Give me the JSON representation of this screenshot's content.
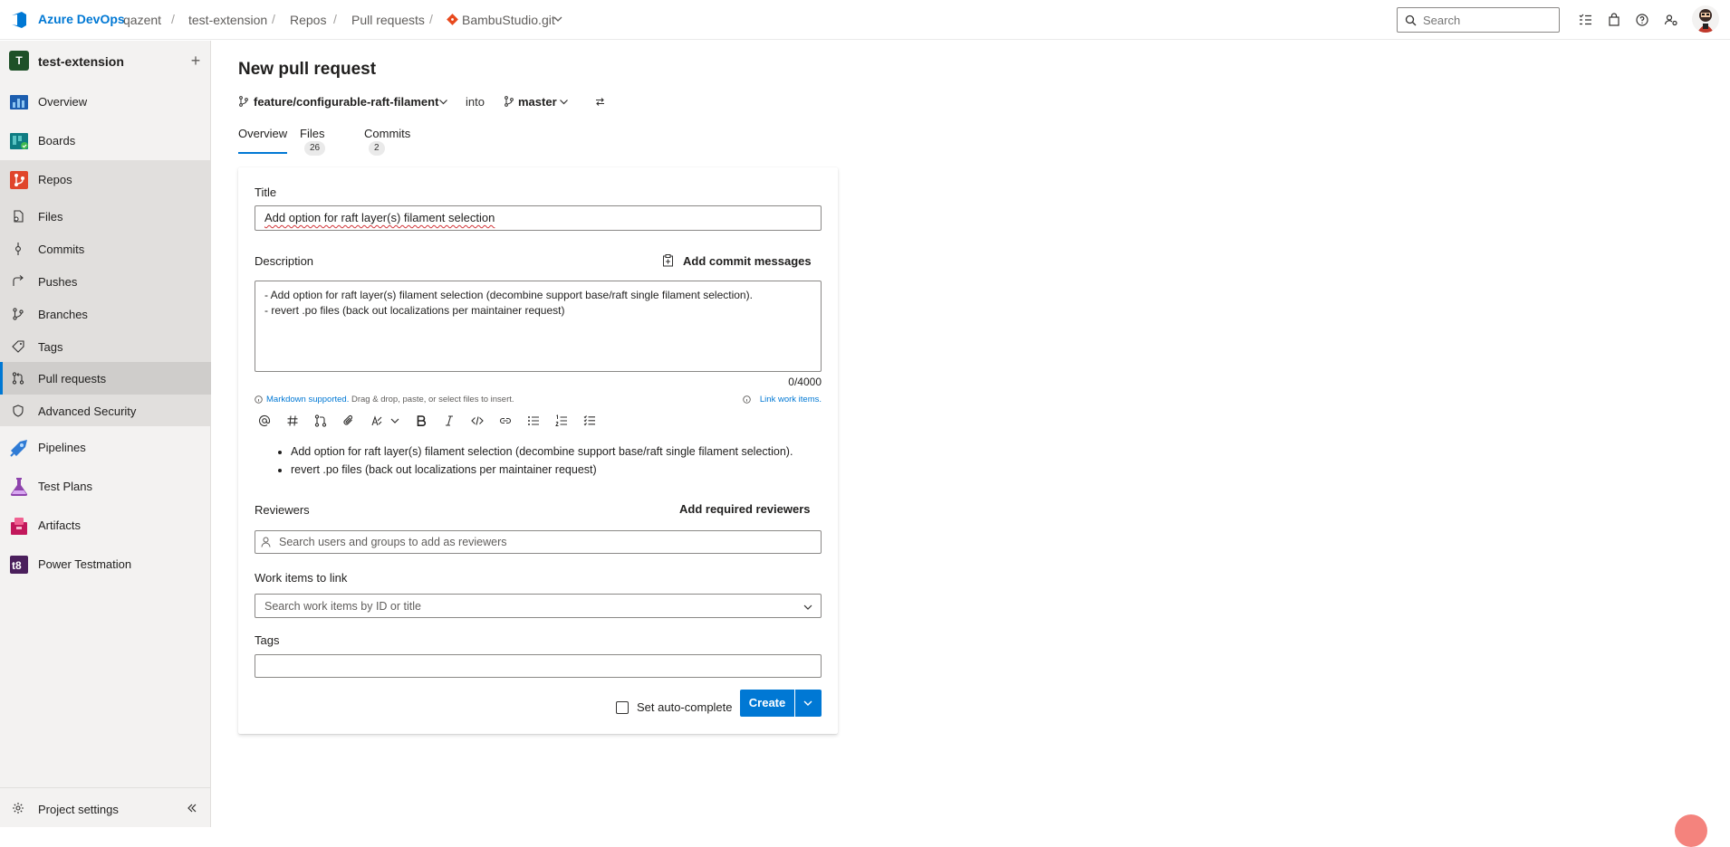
{
  "topbar": {
    "brand": "Azure DevOps",
    "breadcrumb": [
      "qazent",
      "test-extension",
      "Repos",
      "Pull requests"
    ],
    "repo": "BambuStudio.git",
    "search_placeholder": "Search"
  },
  "sidebar": {
    "project_initial": "T",
    "project_name": "test-extension",
    "items": [
      {
        "label": "Overview"
      },
      {
        "label": "Boards"
      },
      {
        "label": "Repos"
      },
      {
        "label": "Files"
      },
      {
        "label": "Commits"
      },
      {
        "label": "Pushes"
      },
      {
        "label": "Branches"
      },
      {
        "label": "Tags"
      },
      {
        "label": "Pull requests"
      },
      {
        "label": "Advanced Security"
      },
      {
        "label": "Pipelines"
      },
      {
        "label": "Test Plans"
      },
      {
        "label": "Artifacts"
      },
      {
        "label": "Power Testmation"
      }
    ],
    "settings_label": "Project settings"
  },
  "main": {
    "title": "New pull request",
    "source_branch": "feature/configurable-raft-filament",
    "into_label": "into",
    "target_branch": "master",
    "tabs": [
      {
        "label": "Overview"
      },
      {
        "label": "Files",
        "count": "26"
      },
      {
        "label": "Commits",
        "count": "2"
      }
    ]
  },
  "form": {
    "title_label": "Title",
    "title_value": "Add option for raft layer(s) filament selection",
    "description_label": "Description",
    "add_commit_messages": "Add commit messages",
    "description_lines": [
      "- Add option for raft layer(s) filament selection (decombine support base/raft single filament selection).",
      "- revert .po files (back out localizations per maintainer request)"
    ],
    "char_counter": "0/4000",
    "markdown_link": "Markdown supported.",
    "markdown_hint": "Drag & drop, paste, or select files to insert.",
    "link_work_items": "Link work items.",
    "preview_items": [
      "Add option for raft layer(s) filament selection (decombine support base/raft single filament selection).",
      "revert .po files (back out localizations per maintainer request)"
    ],
    "reviewers_label": "Reviewers",
    "add_required_reviewers": "Add required reviewers",
    "reviewers_placeholder": "Search users and groups to add as reviewers",
    "work_items_label": "Work items to link",
    "work_items_placeholder": "Search work items by ID or title",
    "tags_label": "Tags",
    "autocomplete_label": "Set auto-complete",
    "create_label": "Create"
  },
  "colors": {
    "accent": "#0078d4",
    "sidebar_bg": "#f3f2f1"
  }
}
